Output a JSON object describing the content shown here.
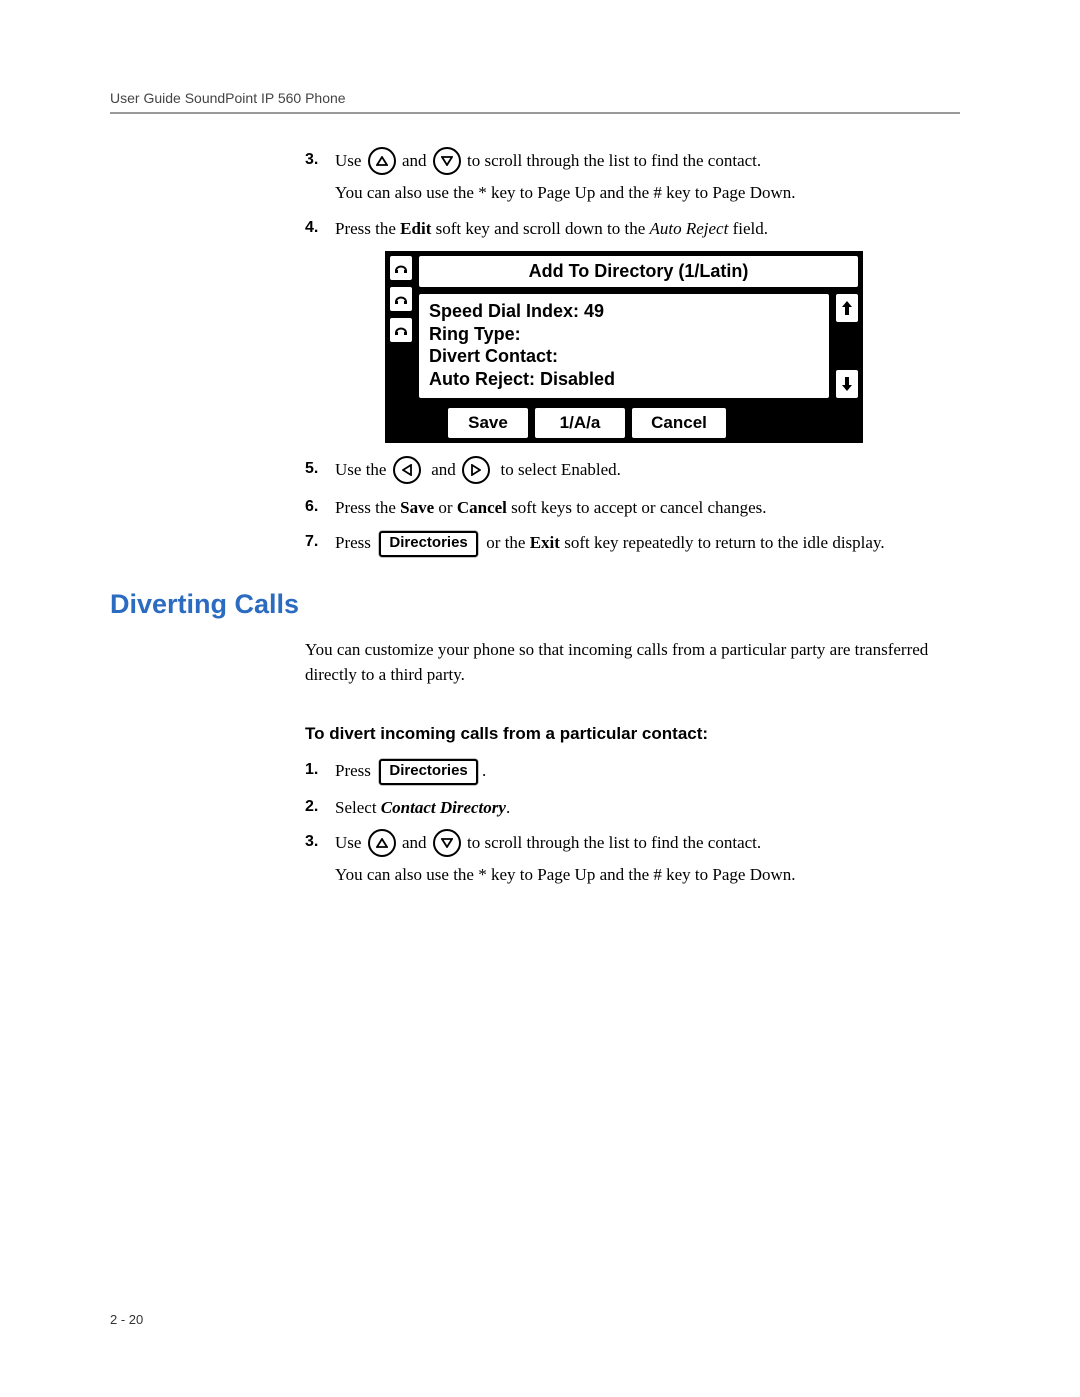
{
  "header": "User Guide SoundPoint IP 560 Phone",
  "step3": {
    "pre": "Use",
    "mid": "and",
    "post": "to scroll through the list to find the contact.",
    "note": "You can also use the * key to Page Up and the # key to Page Down."
  },
  "step4": {
    "pre": "Press the ",
    "bold": "Edit",
    "mid": " soft key and scroll down to the ",
    "italic": "Auto Reject",
    "post": " field."
  },
  "phone": {
    "title": "Add To Directory (1/Latin)",
    "line1": "Speed Dial Index: 49",
    "line2": "Ring Type:",
    "line3": "Divert Contact:",
    "line4": "Auto Reject: Disabled",
    "soft1": "Save",
    "soft2": "1/A/a",
    "soft3": "Cancel"
  },
  "step5": {
    "pre": "Use the",
    "mid": "and",
    "post": "to select Enabled."
  },
  "step6": {
    "pre": "Press the ",
    "bold1": "Save",
    "mid1": " or ",
    "bold2": "Cancel",
    "post": " soft keys to accept or cancel changes."
  },
  "step7": {
    "pre": "Press",
    "btn": "Directories",
    "mid": " or the ",
    "bold": "Exit",
    "post": " soft key repeatedly to return to the idle display."
  },
  "section": "Diverting Calls",
  "intro": "You can customize your phone so that incoming calls from a particular party are transferred directly to a third party.",
  "subheading": "To divert incoming calls from a particular contact:",
  "d_step1": {
    "pre": "Press",
    "btn": "Directories",
    "post": "."
  },
  "d_step2": {
    "pre": "Select ",
    "italic": "Contact Directory",
    "post": "."
  },
  "d_step3": {
    "pre": "Use",
    "mid": "and",
    "post": "to scroll through the list to find the contact.",
    "note": "You can also use the * key to Page Up and the # key to Page Down."
  },
  "pagenum": "2 - 20",
  "nums": {
    "n1": "1.",
    "n2": "2.",
    "n3": "3.",
    "n4": "4.",
    "n5": "5.",
    "n6": "6.",
    "n7": "7."
  }
}
